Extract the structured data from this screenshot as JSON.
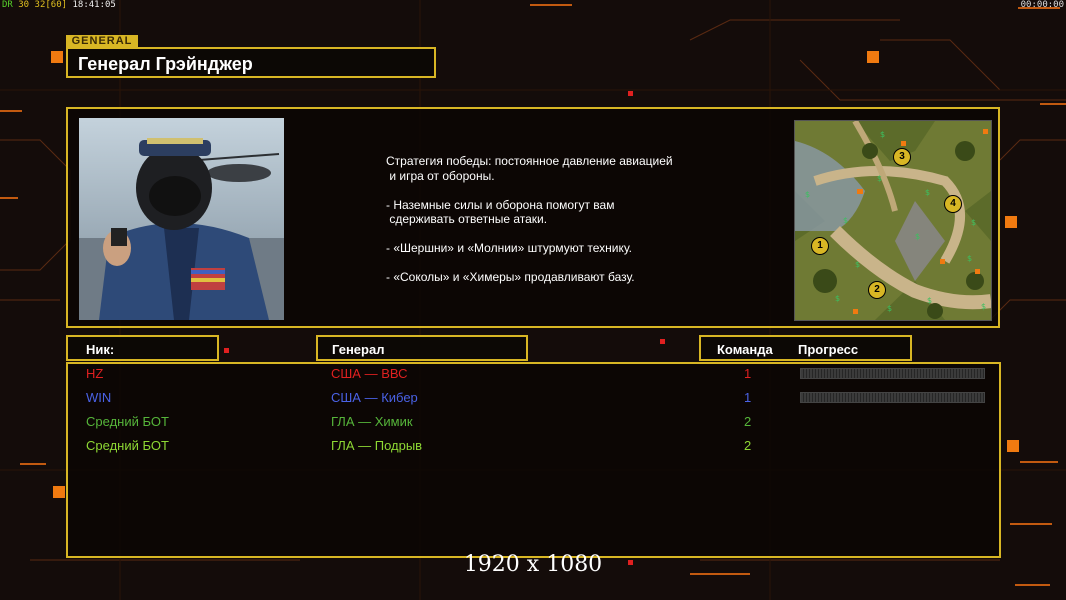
{
  "hud": {
    "stats_dr": "DR",
    "stats_30": "30",
    "stats_32": "32",
    "stats_60": "[60]",
    "clock": "18:41:05",
    "timer": "00:00:00"
  },
  "general": {
    "tag": "GENERAL",
    "name": "Генерал Грэйнджер",
    "description": [
      "Стратегия победы: постоянное давление авиацией\n и игра от обороны.",
      "- Наземные силы и оборона помогут вам\n сдерживать ответные атаки.",
      "- «Шершни» и «Молнии» штурмуют технику.",
      "- «Соколы» и «Химеры» продавливают базу."
    ]
  },
  "minimap": {
    "start_positions": [
      "1",
      "2",
      "3",
      "4"
    ]
  },
  "table": {
    "headers": {
      "nick": "Ник:",
      "general": "Генерал",
      "team": "Команда",
      "progress": "Прогресс"
    },
    "players": [
      {
        "nick": "HZ",
        "general": "США — ВВС",
        "team": "1",
        "color": "#e02020",
        "has_progress": true
      },
      {
        "nick": "WIN",
        "general": "США — Кибер",
        "team": "1",
        "color": "#4a62e6",
        "has_progress": true
      },
      {
        "nick": "Средний БОТ",
        "general": "ГЛА — Химик",
        "team": "2",
        "color": "#56b53a",
        "has_progress": false
      },
      {
        "nick": "Средний БОТ",
        "general": "ГЛА — Подрыв",
        "team": "2",
        "color": "#8ed834",
        "has_progress": false
      }
    ]
  },
  "resolution": "1920 x 1080",
  "colors": {
    "accent": "#d8b624",
    "orange": "#f07a10"
  }
}
